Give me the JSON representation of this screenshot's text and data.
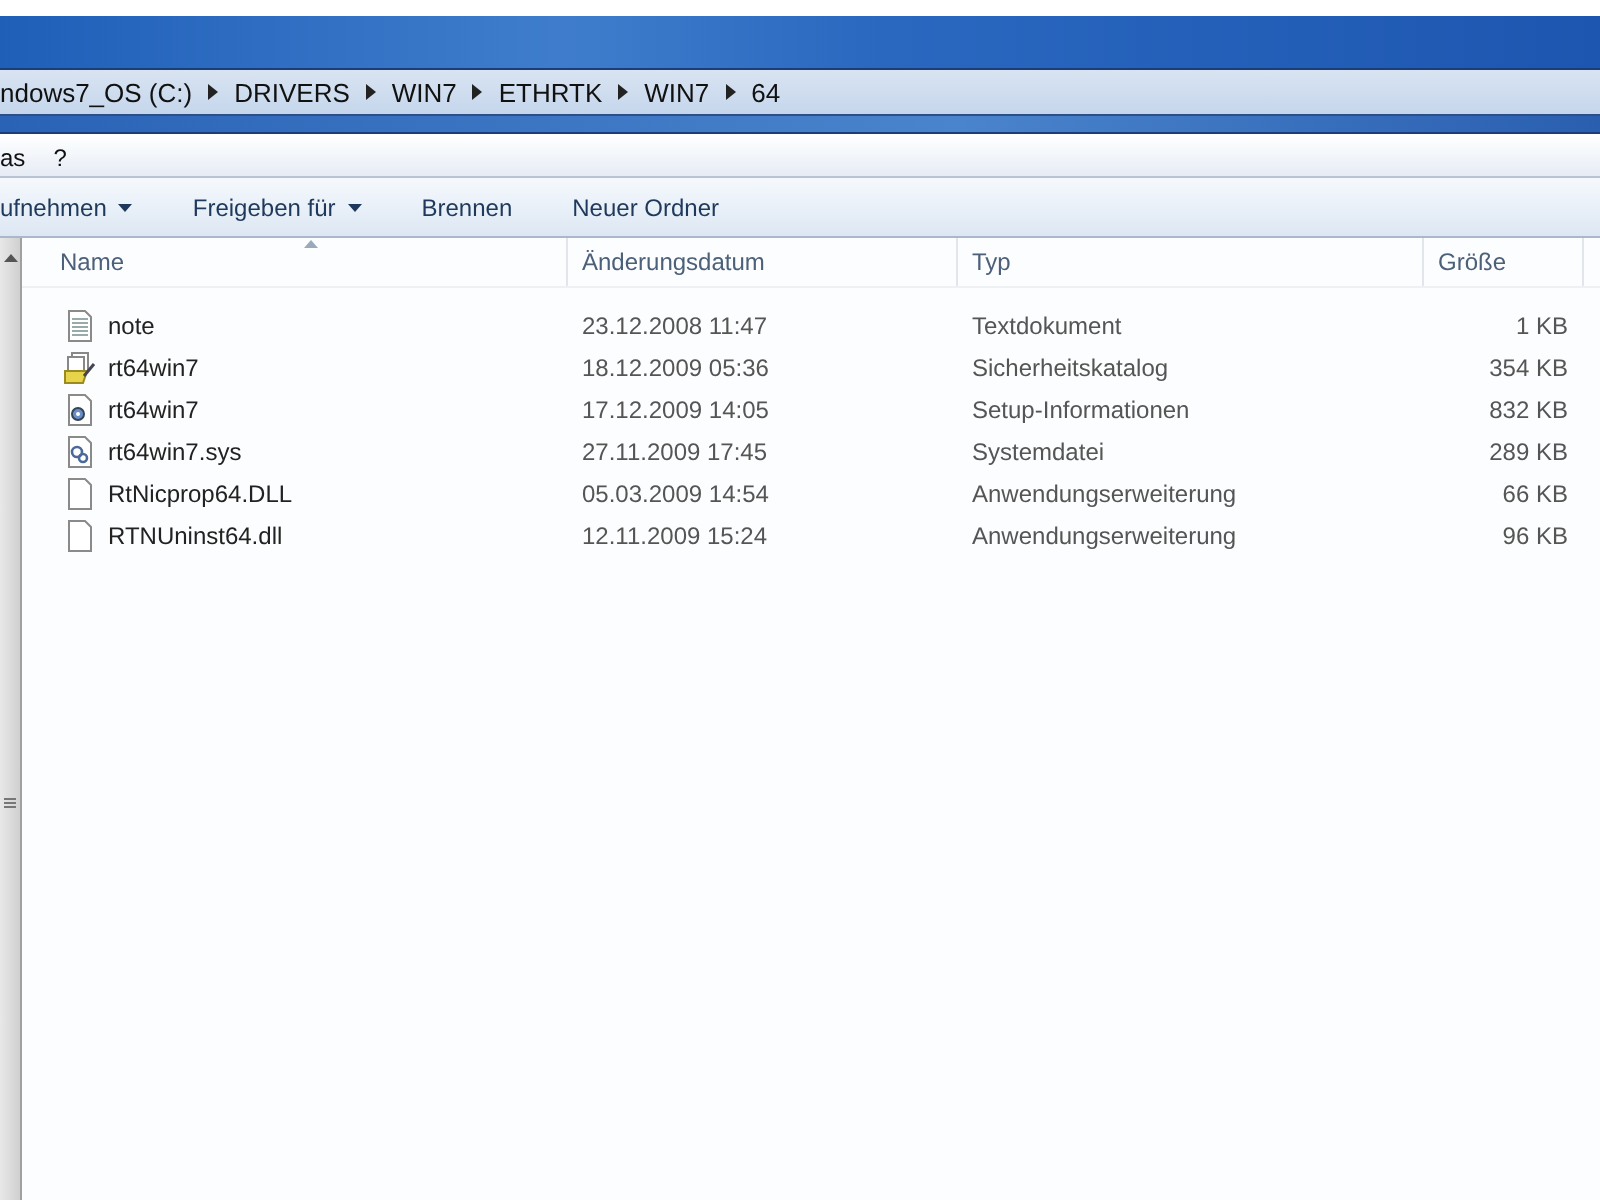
{
  "breadcrumb": [
    "ndows7_OS (C:)",
    "DRIVERS",
    "WIN7",
    "ETHRTK",
    "WIN7",
    "64"
  ],
  "menu": [
    "as",
    "?"
  ],
  "toolbar": [
    {
      "label": "ufnehmen",
      "dropdown": true
    },
    {
      "label": "Freigeben für",
      "dropdown": true
    },
    {
      "label": "Brennen",
      "dropdown": false
    },
    {
      "label": "Neuer Ordner",
      "dropdown": false
    }
  ],
  "columns": [
    "Name",
    "Änderungsdatum",
    "Typ",
    "Größe"
  ],
  "files": [
    {
      "name": "note",
      "date": "23.12.2008 11:47",
      "type": "Textdokument",
      "size": "1 KB",
      "kind": "text"
    },
    {
      "name": "rt64win7",
      "date": "18.12.2009 05:36",
      "type": "Sicherheitskatalog",
      "size": "354 KB",
      "kind": "catalog"
    },
    {
      "name": "rt64win7",
      "date": "17.12.2009 14:05",
      "type": "Setup-Informationen",
      "size": "832 KB",
      "kind": "setup"
    },
    {
      "name": "rt64win7.sys",
      "date": "27.11.2009 17:45",
      "type": "Systemdatei",
      "size": "289 KB",
      "kind": "system"
    },
    {
      "name": "RtNicprop64.DLL",
      "date": "05.03.2009 14:54",
      "type": "Anwendungserweiterung",
      "size": "66 KB",
      "kind": "blank"
    },
    {
      "name": "RTNUninst64.dll",
      "date": "12.11.2009 15:24",
      "type": "Anwendungserweiterung",
      "size": "96 KB",
      "kind": "blank"
    }
  ]
}
